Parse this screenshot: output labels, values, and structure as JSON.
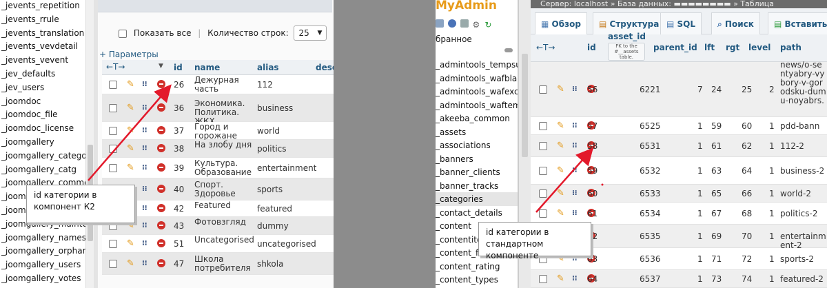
{
  "left_tree": [
    "_jevents_repetition",
    "_jevents_rrule",
    "_jevents_translation",
    "_jevents_vevdetail",
    "_jevents_vevent",
    "_jev_defaults",
    "_jev_users",
    "_joomdoc",
    "_joomdoc_file",
    "_joomdoc_license",
    "_joomgallery",
    "_joomgallery_category",
    "_joomgallery_catg",
    "_joomgallery_comments",
    "_joomgallery_config",
    "_joomgallery_image",
    "_joomgallery_maintenance",
    "_joomgallery_nameshields",
    "_joomgallery_orphans",
    "_joomgallery_users",
    "_joomgallery_votes"
  ],
  "left_panel": {
    "show_all": "Показать все",
    "rows_count_label": "Количество строк:",
    "rows_count_value": "25",
    "params_link": "+ Параметры",
    "sort_arrows": "←T→",
    "columns": [
      "id",
      "name",
      "alias",
      "descr"
    ],
    "rows": [
      {
        "id": "26",
        "name": "Дежурная часть",
        "alias": "112"
      },
      {
        "id": "36",
        "name": "Экономика. Политика. ЖКХ",
        "alias": "business"
      },
      {
        "id": "37",
        "name": "Город и горожане",
        "alias": "world"
      },
      {
        "id": "38",
        "name": "На злобу дня",
        "alias": "politics"
      },
      {
        "id": "39",
        "name": "Культура. Образование",
        "alias": "entertainment"
      },
      {
        "id": "40",
        "name": "Спорт. Здоровье",
        "alias": "sports"
      },
      {
        "id": "42",
        "name": "Featured",
        "alias": "featured"
      },
      {
        "id": "43",
        "name": "Фотовзгляд",
        "alias": "dummy"
      },
      {
        "id": "51",
        "name": "Uncategorised",
        "alias": "uncategorised"
      },
      {
        "id": "47",
        "name": "Школа потребителя",
        "alias": "shkola"
      }
    ]
  },
  "left_note": "id категории в компонент К2",
  "right_tree": {
    "logo": "MyAdmin",
    "favorites": "бранное",
    "items": [
      "_admintools_tempsup",
      "_admintools_wafblack",
      "_admintools_wafexcep",
      "_admintools_waftemp",
      "_akeeba_common",
      "_assets",
      "_associations",
      "_banners",
      "_banner_clients",
      "_banner_tracks",
      "_categories",
      "_contact_details",
      "_content",
      "_contentitem_tag",
      "_content_frontpage",
      "_content_rating",
      "_content_types"
    ]
  },
  "right_panel": {
    "server_bar": "Сервер: localhost » База данных: ▬▬▬▬▬▬▬▬ » Таблица",
    "tabs": [
      "Обзор",
      "Структура",
      "SQL",
      "Поиск",
      "Вставить"
    ],
    "sort_arrows": "←T→",
    "columns": [
      "id",
      "asset_id",
      "parent_id",
      "lft",
      "rgt",
      "level",
      "path"
    ],
    "asset_fk_note": "FK to the #__assets table.",
    "rows": [
      {
        "id": "56",
        "asset_id": "6221",
        "parent_id": "7",
        "lft": "24",
        "rgt": "25",
        "level": "2",
        "path": "news/o-sentyabry-vybory-v-gorodsku-dumu-noyabrs."
      },
      {
        "id": "57",
        "asset_id": "6525",
        "parent_id": "1",
        "lft": "59",
        "rgt": "60",
        "level": "1",
        "path": "pdd-bann"
      },
      {
        "id": "58",
        "asset_id": "6531",
        "parent_id": "1",
        "lft": "61",
        "rgt": "62",
        "level": "1",
        "path": "112-2"
      },
      {
        "id": "59",
        "asset_id": "6532",
        "parent_id": "1",
        "lft": "63",
        "rgt": "64",
        "level": "1",
        "path": "business-2"
      },
      {
        "id": "60",
        "asset_id": "6533",
        "parent_id": "1",
        "lft": "65",
        "rgt": "66",
        "level": "1",
        "path": "world-2"
      },
      {
        "id": "61",
        "asset_id": "6534",
        "parent_id": "1",
        "lft": "67",
        "rgt": "68",
        "level": "1",
        "path": "politics-2"
      },
      {
        "id": "62",
        "asset_id": "6535",
        "parent_id": "1",
        "lft": "69",
        "rgt": "70",
        "level": "1",
        "path": "entertainment-2"
      },
      {
        "id": "63",
        "asset_id": "6536",
        "parent_id": "1",
        "lft": "71",
        "rgt": "72",
        "level": "1",
        "path": "sports-2"
      },
      {
        "id": "64",
        "asset_id": "6537",
        "parent_id": "1",
        "lft": "73",
        "rgt": "74",
        "level": "1",
        "path": "featured-2"
      }
    ]
  },
  "right_note": "id категории в стандартном компоненте",
  "colors": {
    "accent": "#235a81",
    "arrow": "#e3192b",
    "delete": "#d0302a",
    "edit": "#e39a1b"
  }
}
